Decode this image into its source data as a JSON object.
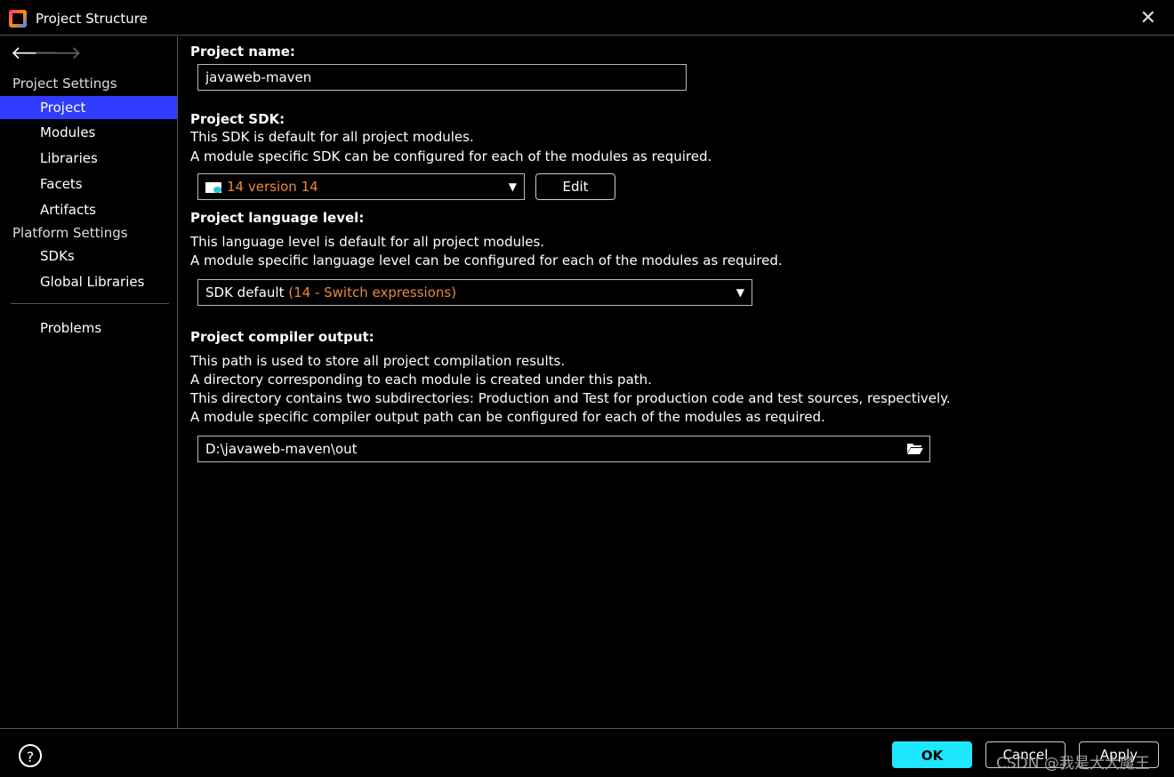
{
  "window": {
    "title": "Project Structure"
  },
  "sidebar": {
    "project_settings_header": "Project Settings",
    "items": [
      {
        "label": "Project",
        "selected": true
      },
      {
        "label": "Modules"
      },
      {
        "label": "Libraries"
      },
      {
        "label": "Facets"
      },
      {
        "label": "Artifacts"
      }
    ],
    "platform_settings_header": "Platform Settings",
    "platform_items": [
      {
        "label": "SDKs"
      },
      {
        "label": "Global Libraries"
      }
    ],
    "problems_label": "Problems"
  },
  "main": {
    "project_name_label": "Project name:",
    "project_name_value": "javaweb-maven",
    "sdk_label": "Project SDK:",
    "sdk_desc_1": "This SDK is default for all project modules.",
    "sdk_desc_2": "A module specific SDK can be configured for each of the modules as required.",
    "sdk_value_num": "14",
    "sdk_value_name": "version 14",
    "sdk_edit_button": "Edit",
    "lang_label": "Project language level:",
    "lang_desc_1": "This language level is default for all project modules.",
    "lang_desc_2": "A module specific language level can be configured for each of the modules as required.",
    "lang_value_prefix": "SDK default",
    "lang_value_detail": "(14 - Switch expressions)",
    "output_label": "Project compiler output:",
    "output_desc_1": "This path is used to store all project compilation results.",
    "output_desc_2": "A directory corresponding to each module is created under this path.",
    "output_desc_3": "This directory contains two subdirectories: Production and Test for production code and test sources, respectively.",
    "output_desc_4": "A module specific compiler output path can be configured for each of the modules as required.",
    "output_path": "D:\\javaweb-maven\\out"
  },
  "footer": {
    "help": "?",
    "ok": "OK",
    "cancel": "Cancel",
    "apply": "Apply",
    "watermark": "CSDN @我是大大魔王"
  },
  "colors": {
    "selection": "#2f3bff",
    "ok_button": "#1ee8ff",
    "accent_orange": "#e8883a"
  }
}
